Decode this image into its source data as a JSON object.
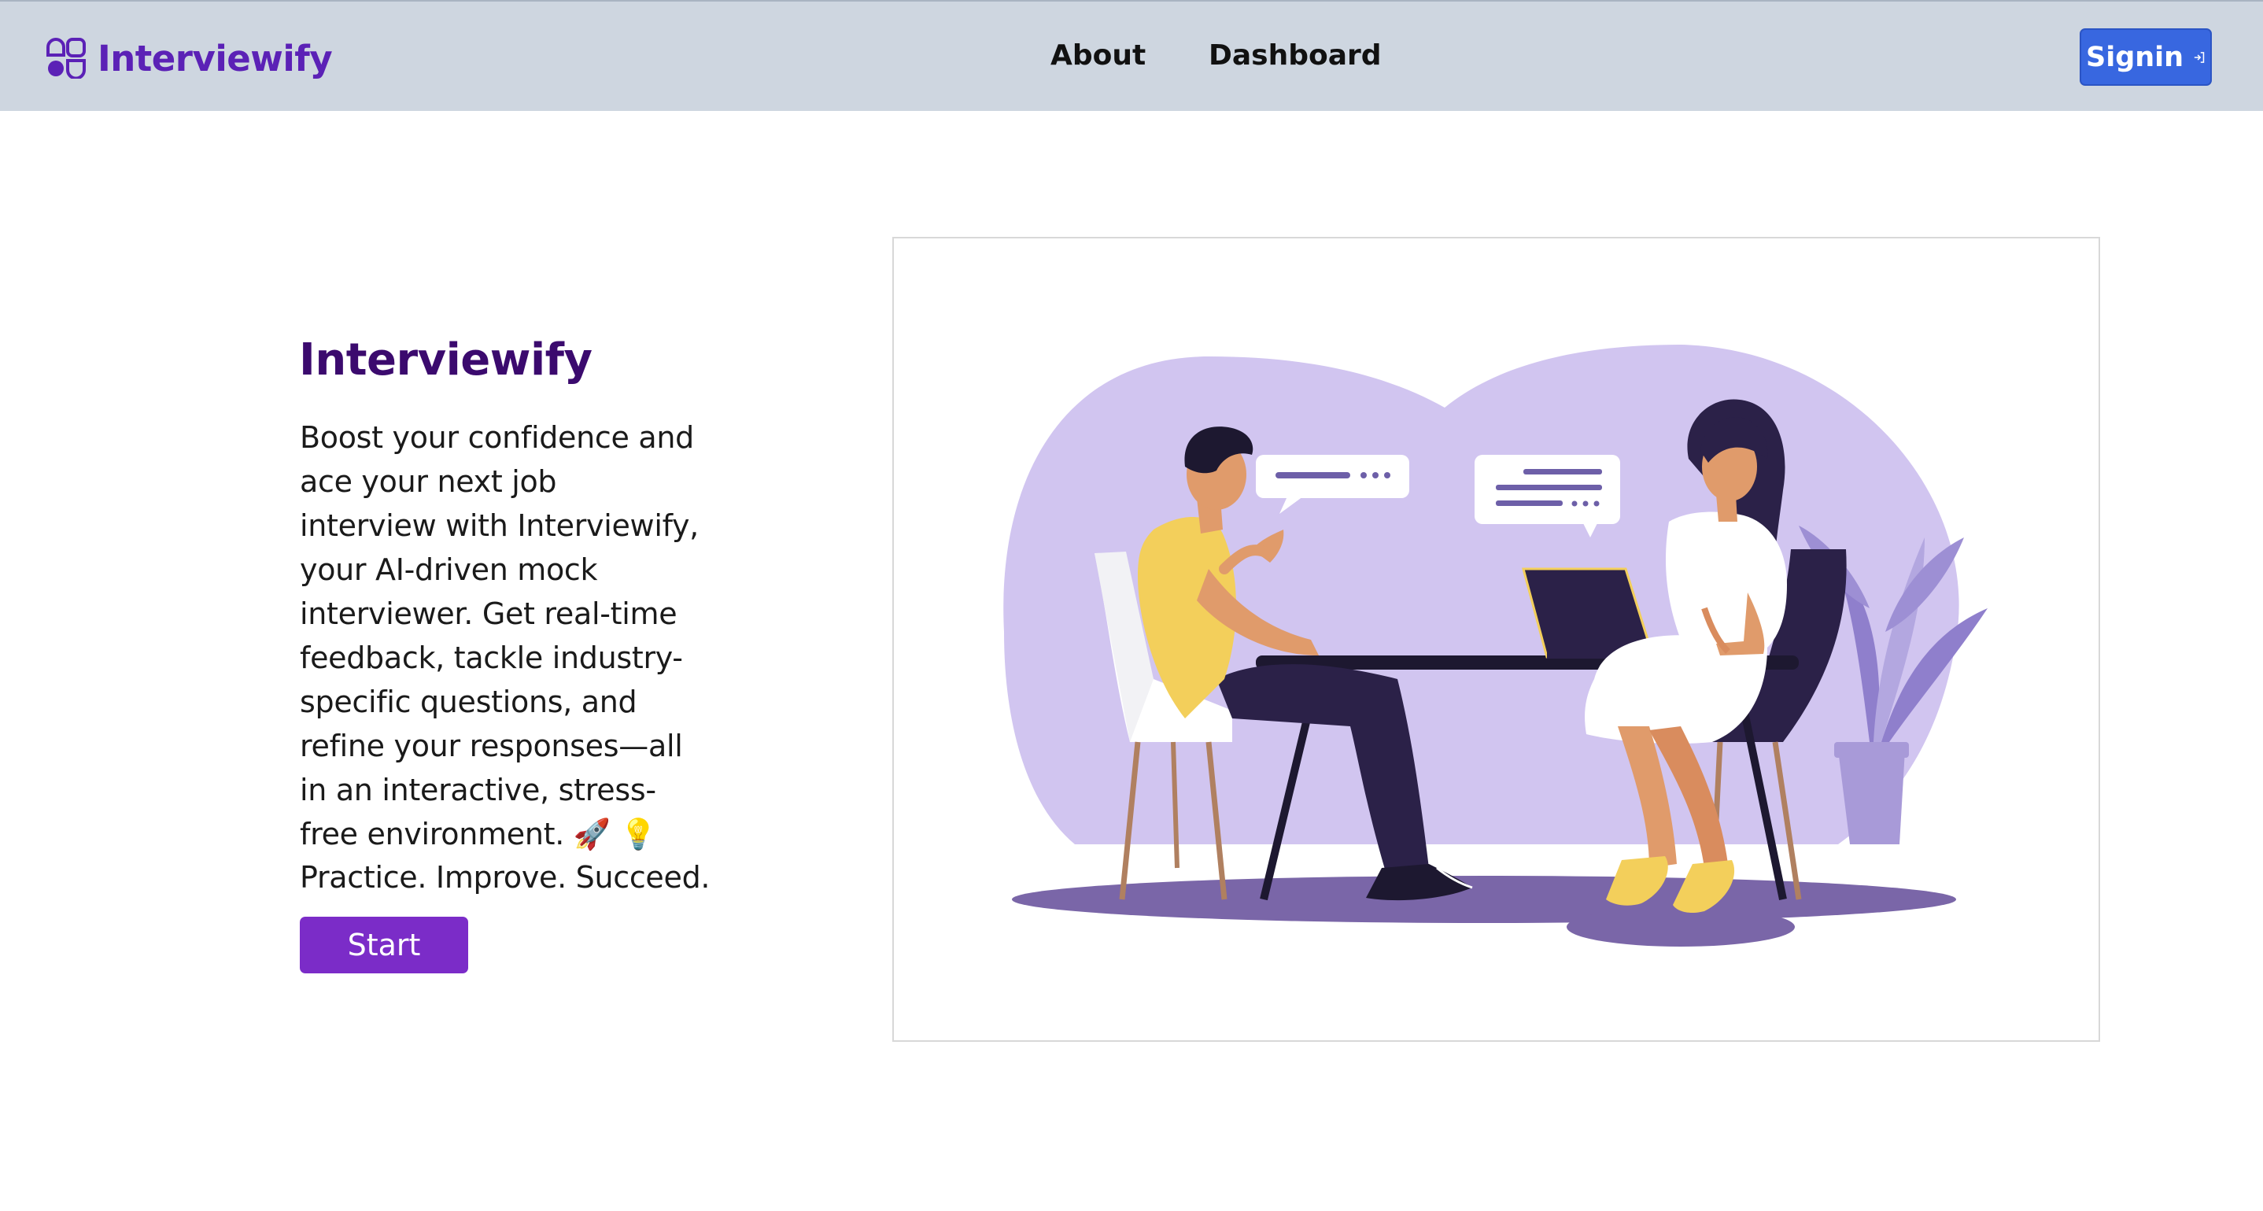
{
  "navbar": {
    "brand_name": "Interviewify",
    "brand_icon": "shapes-logo-icon",
    "links": [
      {
        "label": "About"
      },
      {
        "label": "Dashboard"
      }
    ],
    "signin": {
      "label": "Signin",
      "icon": "sign-in-arrow-icon"
    }
  },
  "hero": {
    "title": "Interviewify",
    "description": "Boost your confidence and ace your next job interview with Interviewify, your AI-driven mock interviewer. Get real-time feedback, tackle industry-specific questions, and refine your responses—all in an interactive, stress-free environment. 🚀 💡",
    "tagline": "Practice. Improve. Succeed.",
    "start_label": "Start"
  },
  "illustration": {
    "subject": "two-people-interview-at-table",
    "colors": {
      "blob": "#d1c5f0",
      "floor": "#7a66a8",
      "accent_purple": "#5b21b6",
      "button_blue": "#3867e0",
      "start_purple": "#7b2cc8",
      "navbar_bg": "#ced6e0"
    }
  }
}
